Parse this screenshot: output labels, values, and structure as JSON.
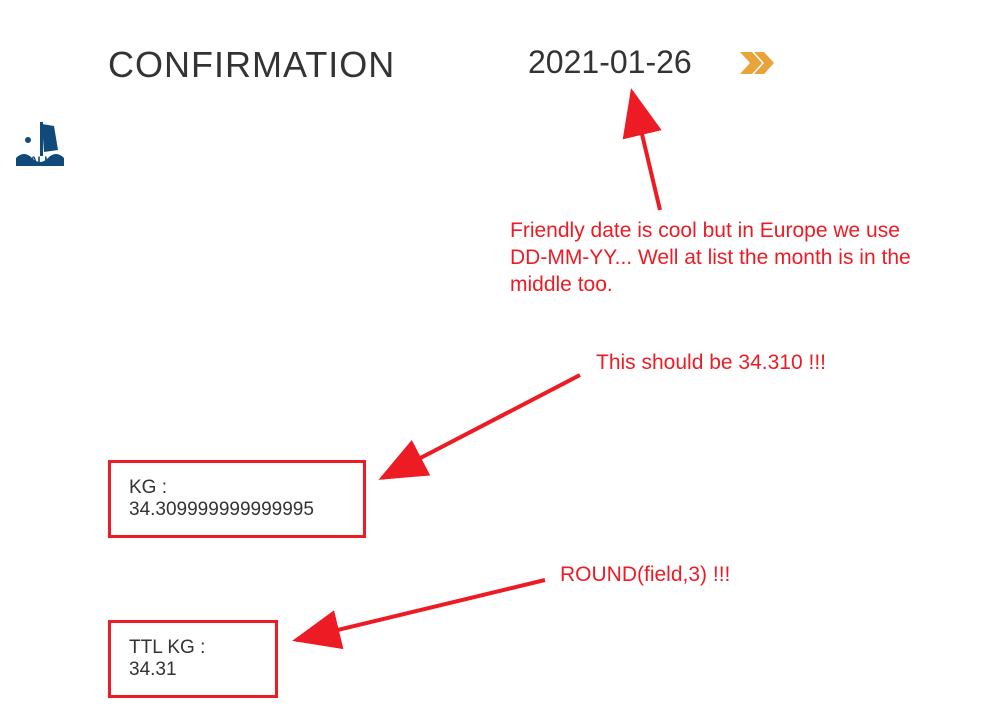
{
  "header": {
    "title": "CONFIRMATION",
    "date": "2021-01-26"
  },
  "fields": {
    "kg_label": "KG : ",
    "kg_value": "34.309999999999995",
    "ttl_label": "TTL KG : ",
    "ttl_value": "34.31"
  },
  "annotations": {
    "date_comment": "Friendly date is cool but in Europe we use DD-MM-YY... Well at list the month is in the middle too.",
    "kg_comment": "This should be 34.310 !!!",
    "round_comment": "ROUND(field,3) !!!"
  },
  "colors": {
    "annotation_red": "#ed1c24",
    "chevron_gold": "#e8a43a",
    "logo_navy": "#104a7a"
  }
}
